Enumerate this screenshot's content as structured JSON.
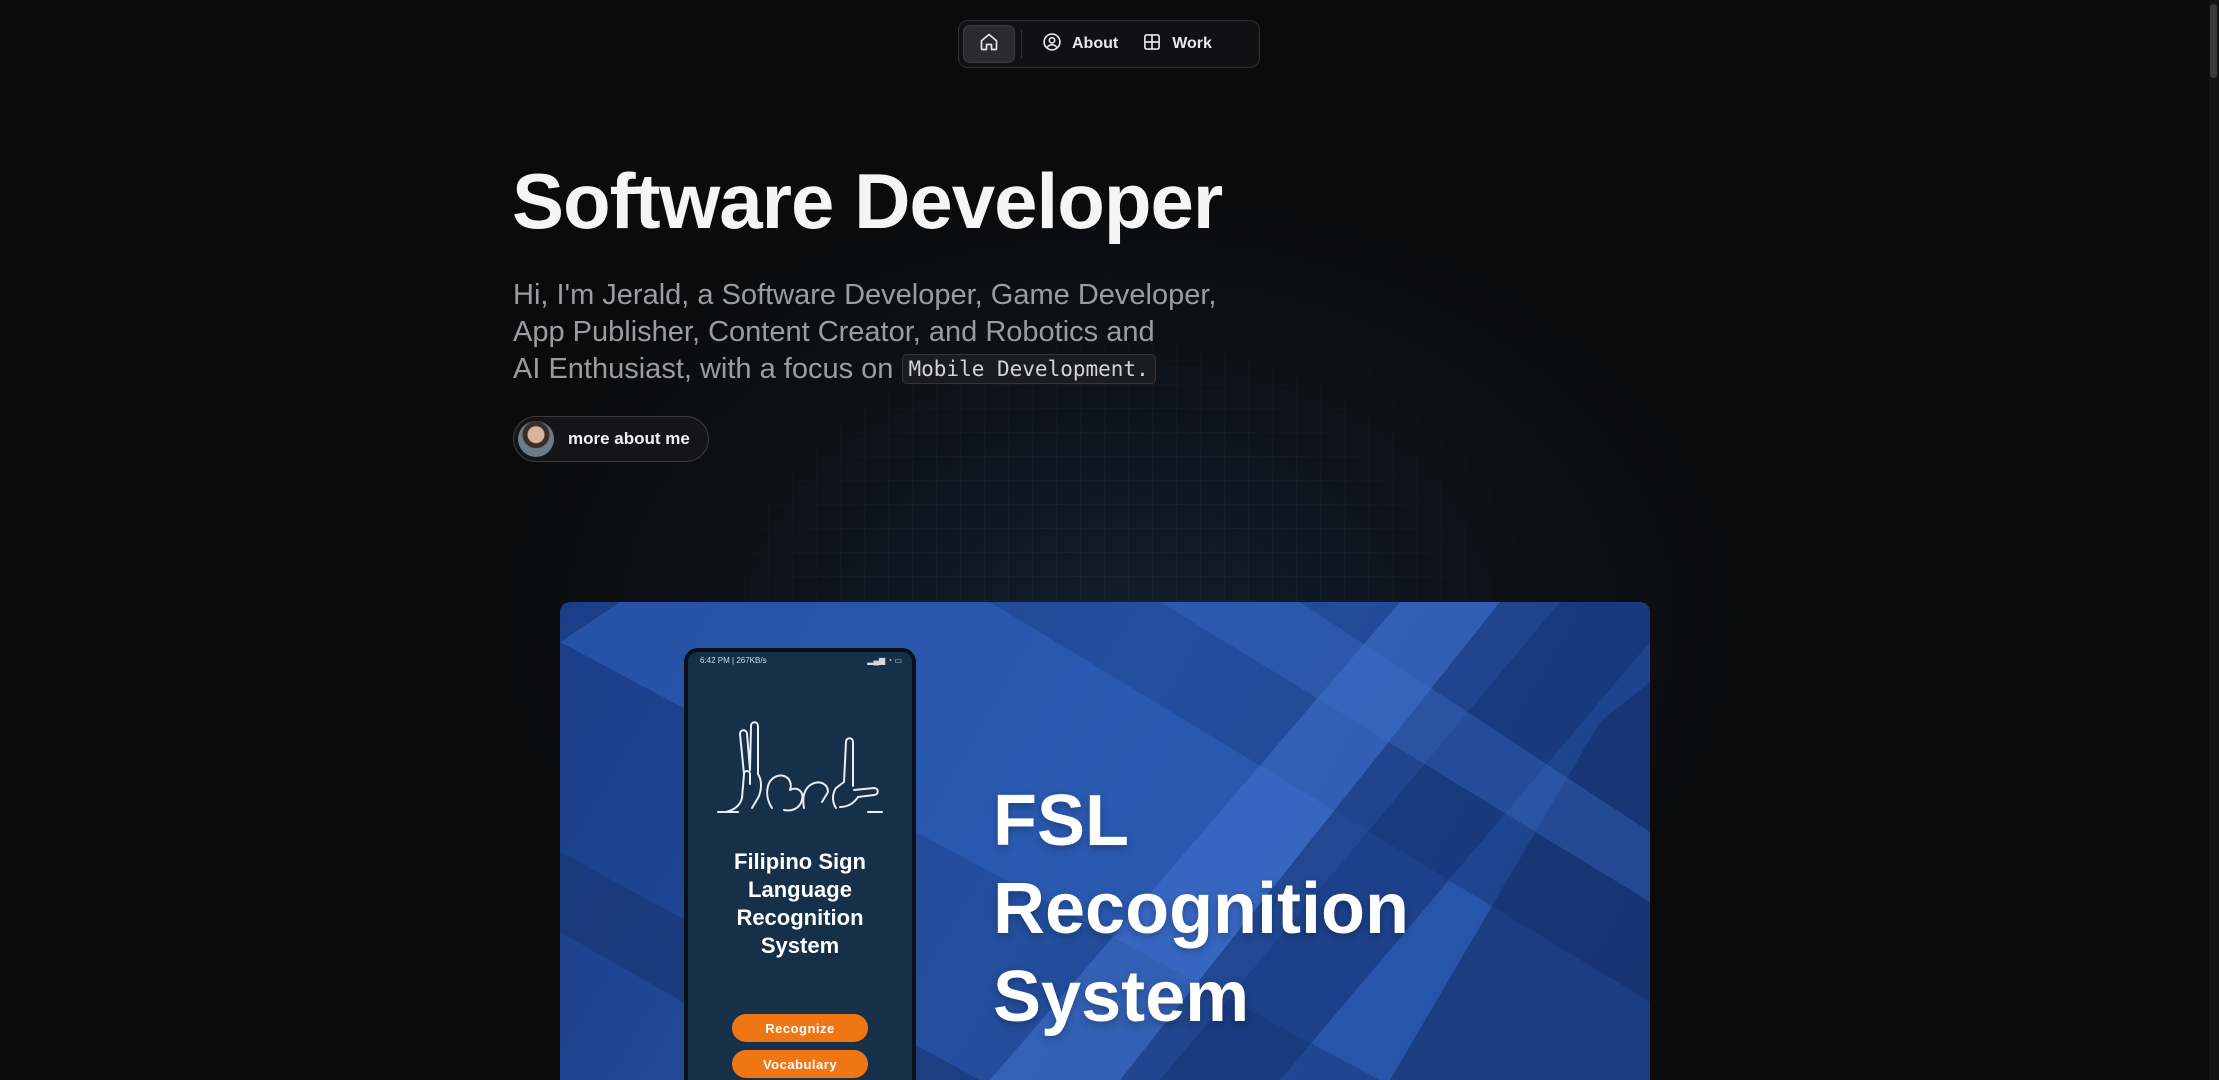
{
  "nav": {
    "home_icon": "home-icon",
    "items": [
      {
        "icon": "user-circle-icon",
        "label": "About"
      },
      {
        "icon": "grid-icon",
        "label": "Work"
      }
    ]
  },
  "hero": {
    "title": "Software Developer",
    "intro_line1": "Hi, I'm Jerald, a Software Developer, Game Developer,",
    "intro_line2": "App Publisher, Content Creator, and Robotics and",
    "intro_line3": "AI Enthusiast, with a focus on",
    "focus_code": "Mobile Development.",
    "about_button": "more about me"
  },
  "project": {
    "title_line1": "FSL",
    "title_line2": "Recognition",
    "title_line3": "System",
    "phone": {
      "status_time": "6:42 PM | 267KB/s",
      "app_title_line1": "Filipino Sign",
      "app_title_line2": "Language",
      "app_title_line3": "Recognition",
      "app_title_line4": "System",
      "button1": "Recognize",
      "button2": "Vocabulary"
    }
  },
  "colors": {
    "background": "#0b0b0c",
    "card_blue": "#244f9f",
    "phone_button": "#f07513"
  }
}
